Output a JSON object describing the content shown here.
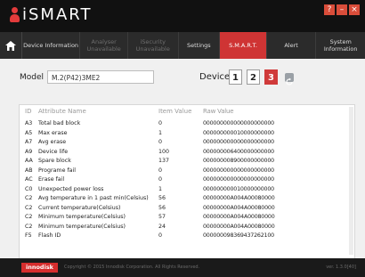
{
  "app": {
    "title": "iSMART"
  },
  "window_buttons": [
    "?",
    "–",
    "×"
  ],
  "nav": {
    "tabs": [
      {
        "label": "Device Information",
        "state": "normal"
      },
      {
        "label": "Analyser Unavailable",
        "state": "disabled"
      },
      {
        "label": "iSecurity Unavailable",
        "state": "disabled"
      },
      {
        "label": "Settings",
        "state": "normal"
      },
      {
        "label": "S.M.A.R.T.",
        "state": "active"
      },
      {
        "label": "Alert",
        "state": "normal"
      },
      {
        "label": "System Information",
        "state": "normal"
      }
    ]
  },
  "model": {
    "label": "Model",
    "value": "M.2(P42)3ME2"
  },
  "device": {
    "label": "Device",
    "buttons": [
      "1",
      "2",
      "3"
    ],
    "selected": "3"
  },
  "table": {
    "headers": {
      "id": "ID",
      "name": "Attribute Name",
      "value": "Item Value",
      "raw": "Raw Value"
    },
    "rows": [
      {
        "id": "A3",
        "name": "Total bad block",
        "value": "0",
        "raw": "000000000000000000000"
      },
      {
        "id": "A5",
        "name": "Max erase",
        "value": "1",
        "raw": "000000000010000000000"
      },
      {
        "id": "A7",
        "name": "Avg erase",
        "value": "0",
        "raw": "000000000000000000000"
      },
      {
        "id": "A9",
        "name": "Device life",
        "value": "100",
        "raw": "000000006400000000000"
      },
      {
        "id": "AA",
        "name": "Spare block",
        "value": "137",
        "raw": "000000008900000000000"
      },
      {
        "id": "AB",
        "name": "Programe fail",
        "value": "0",
        "raw": "000000000000000000000"
      },
      {
        "id": "AC",
        "name": "Erase fail",
        "value": "0",
        "raw": "000000000000000000000"
      },
      {
        "id": "C0",
        "name": "Unexpected power loss",
        "value": "1",
        "raw": "000000000010000000000"
      },
      {
        "id": "C2",
        "name": "Avg temperature in 1 past min(Celsius)",
        "value": "56",
        "raw": "00000000A004A00080000"
      },
      {
        "id": "C2",
        "name": "Current temperature(Celsius)",
        "value": "56",
        "raw": "00000000A004A00080000"
      },
      {
        "id": "C2",
        "name": "Minimum temperature(Celsius)",
        "value": "57",
        "raw": "00000000A004A00080000"
      },
      {
        "id": "C2",
        "name": "Minimum temperature(Celsius)",
        "value": "24",
        "raw": "00000000A004A00080000"
      },
      {
        "id": "F5",
        "name": "Flash ID",
        "value": "0",
        "raw": "000000098369437262100"
      }
    ]
  },
  "footer": {
    "brand": "innodisk",
    "copyright": "Copyright © 2015 Innodisk Corporation. All Rights Reserved.",
    "version": "ver. 1.3.0[40]"
  },
  "colors": {
    "accent": "#cf3434",
    "nav_bg": "#2b2b2b",
    "title_bg": "#111111",
    "content_bg": "#f0f0f0"
  }
}
